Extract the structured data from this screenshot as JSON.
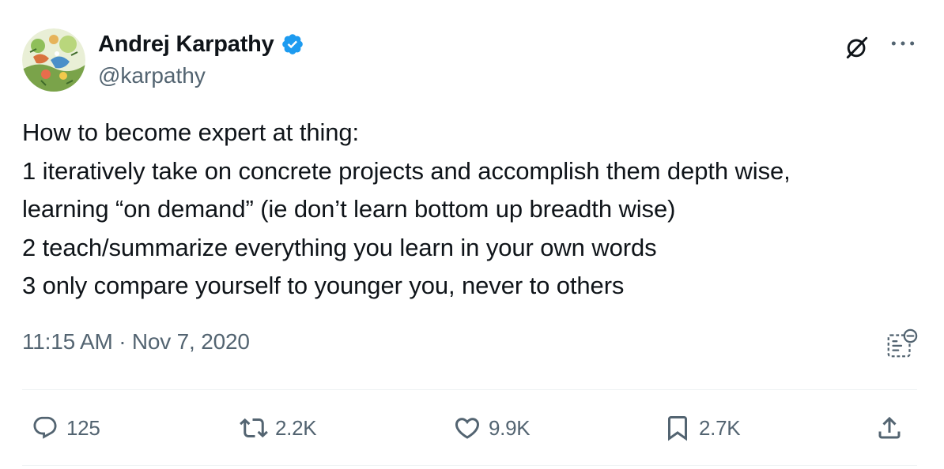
{
  "author": {
    "name": "Andrej Karpathy",
    "handle": "@karpathy",
    "verified": true,
    "verified_color": "#1d9bf0"
  },
  "icons": {
    "avatar": "avatar-image",
    "verified": "verified-badge-icon",
    "grok": "grok-icon",
    "more": "more-icon",
    "qr": "qr-code-icon",
    "reply": "reply-icon",
    "repost": "repost-icon",
    "like": "like-icon",
    "bookmark": "bookmark-icon",
    "share": "share-icon"
  },
  "tweet": {
    "lines": [
      "How to become expert at thing:",
      "1 iteratively take on concrete projects and accomplish them depth wise,",
      "learning “on demand” (ie don’t learn bottom up breadth wise)",
      "2 teach/summarize everything you learn in your own words",
      "3 only compare yourself to younger you, never to others"
    ],
    "timestamp": "11:15 AM · Nov 7, 2020"
  },
  "actions": {
    "replies": "125",
    "reposts": "2.2K",
    "likes": "9.9K",
    "bookmarks": "2.7K"
  },
  "colors": {
    "text": "#0f1419",
    "secondary": "#536471",
    "divider": "#eff3f4",
    "accent": "#1d9bf0"
  }
}
